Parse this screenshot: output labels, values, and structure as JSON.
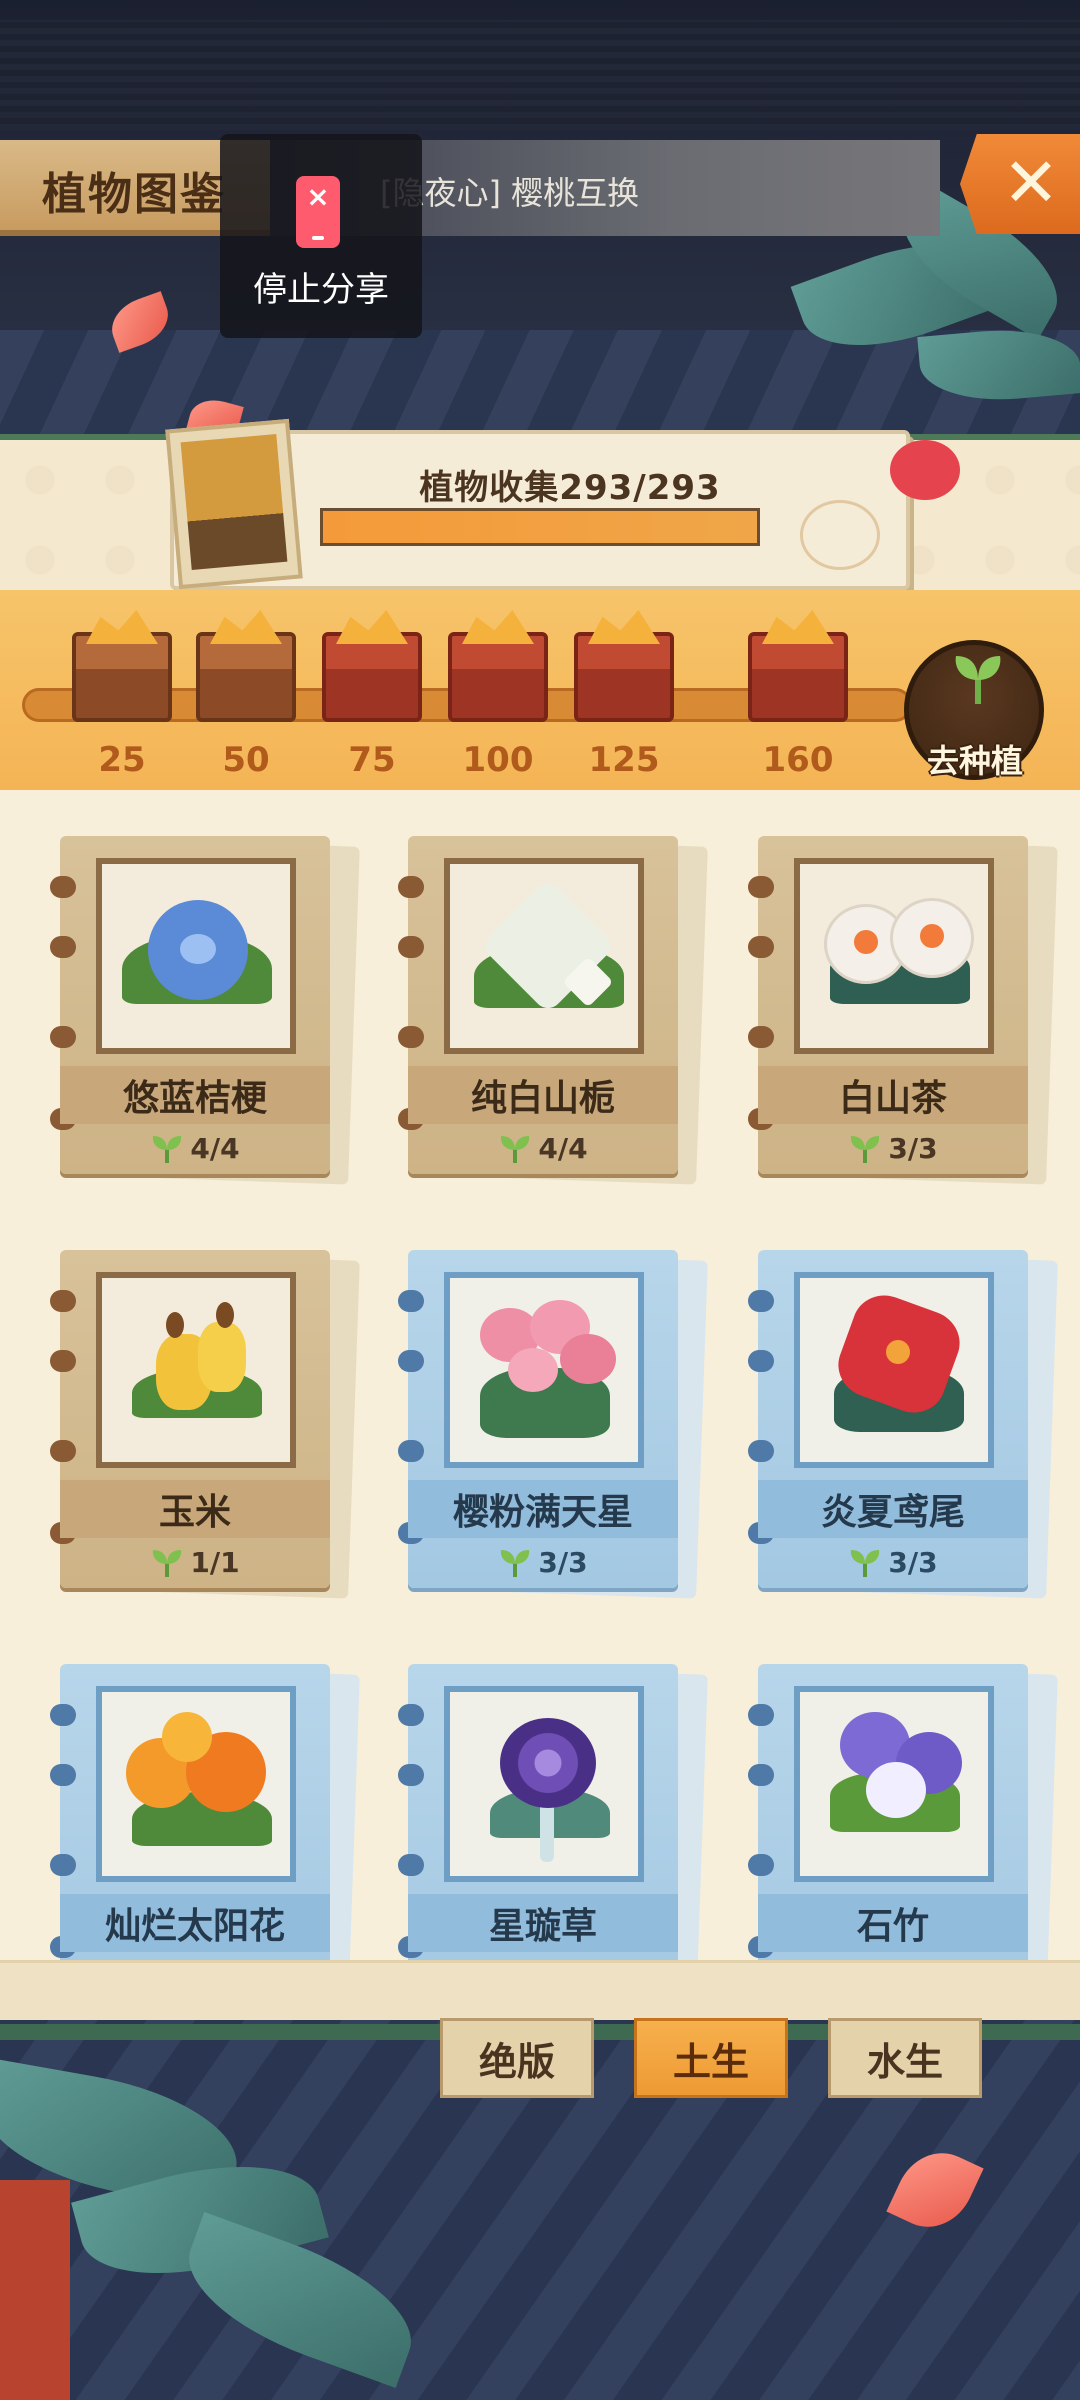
{
  "header": {
    "title": "植物图鉴",
    "notice": "[隐夜心] 樱桃互换",
    "close_symbol": "✕"
  },
  "share_overlay": {
    "label": "停止分享",
    "icon": "phone-share-stop-icon"
  },
  "collection": {
    "label": "植物收集293/293",
    "collected": 293,
    "total": 293
  },
  "rewards": {
    "milestones": [
      "25",
      "50",
      "75",
      "100",
      "125",
      "160"
    ],
    "plant_button_label": "去种植"
  },
  "plants": [
    {
      "name": "悠蓝桔梗",
      "count": "4/4",
      "category": "soil",
      "color": "#5b8ad6"
    },
    {
      "name": "纯白山栀",
      "count": "4/4",
      "category": "soil",
      "color": "#ecefe4"
    },
    {
      "name": "白山茶",
      "count": "3/3",
      "category": "soil",
      "color": "#f4efe8"
    },
    {
      "name": "玉米",
      "count": "1/1",
      "category": "soil",
      "color": "#f2c23a"
    },
    {
      "name": "樱粉满天星",
      "count": "3/3",
      "category": "water",
      "color": "#ef8fa6"
    },
    {
      "name": "炎夏鸢尾",
      "count": "3/3",
      "category": "water",
      "color": "#d8333a"
    },
    {
      "name": "灿烂太阳花",
      "count": "",
      "category": "water",
      "color": "#f39a2a"
    },
    {
      "name": "星璇草",
      "count": "",
      "category": "water",
      "color": "#6f4fb6"
    },
    {
      "name": "石竹",
      "count": "",
      "category": "water",
      "color": "#7d6ad4"
    }
  ],
  "tabs": [
    {
      "label": "绝版",
      "active": false
    },
    {
      "label": "土生",
      "active": true
    },
    {
      "label": "水生",
      "active": false
    }
  ],
  "colors": {
    "accent_orange": "#f08a38",
    "panel_cream": "#f7efda",
    "soil_card": "#cdb386",
    "water_card": "#a3c8e2"
  }
}
